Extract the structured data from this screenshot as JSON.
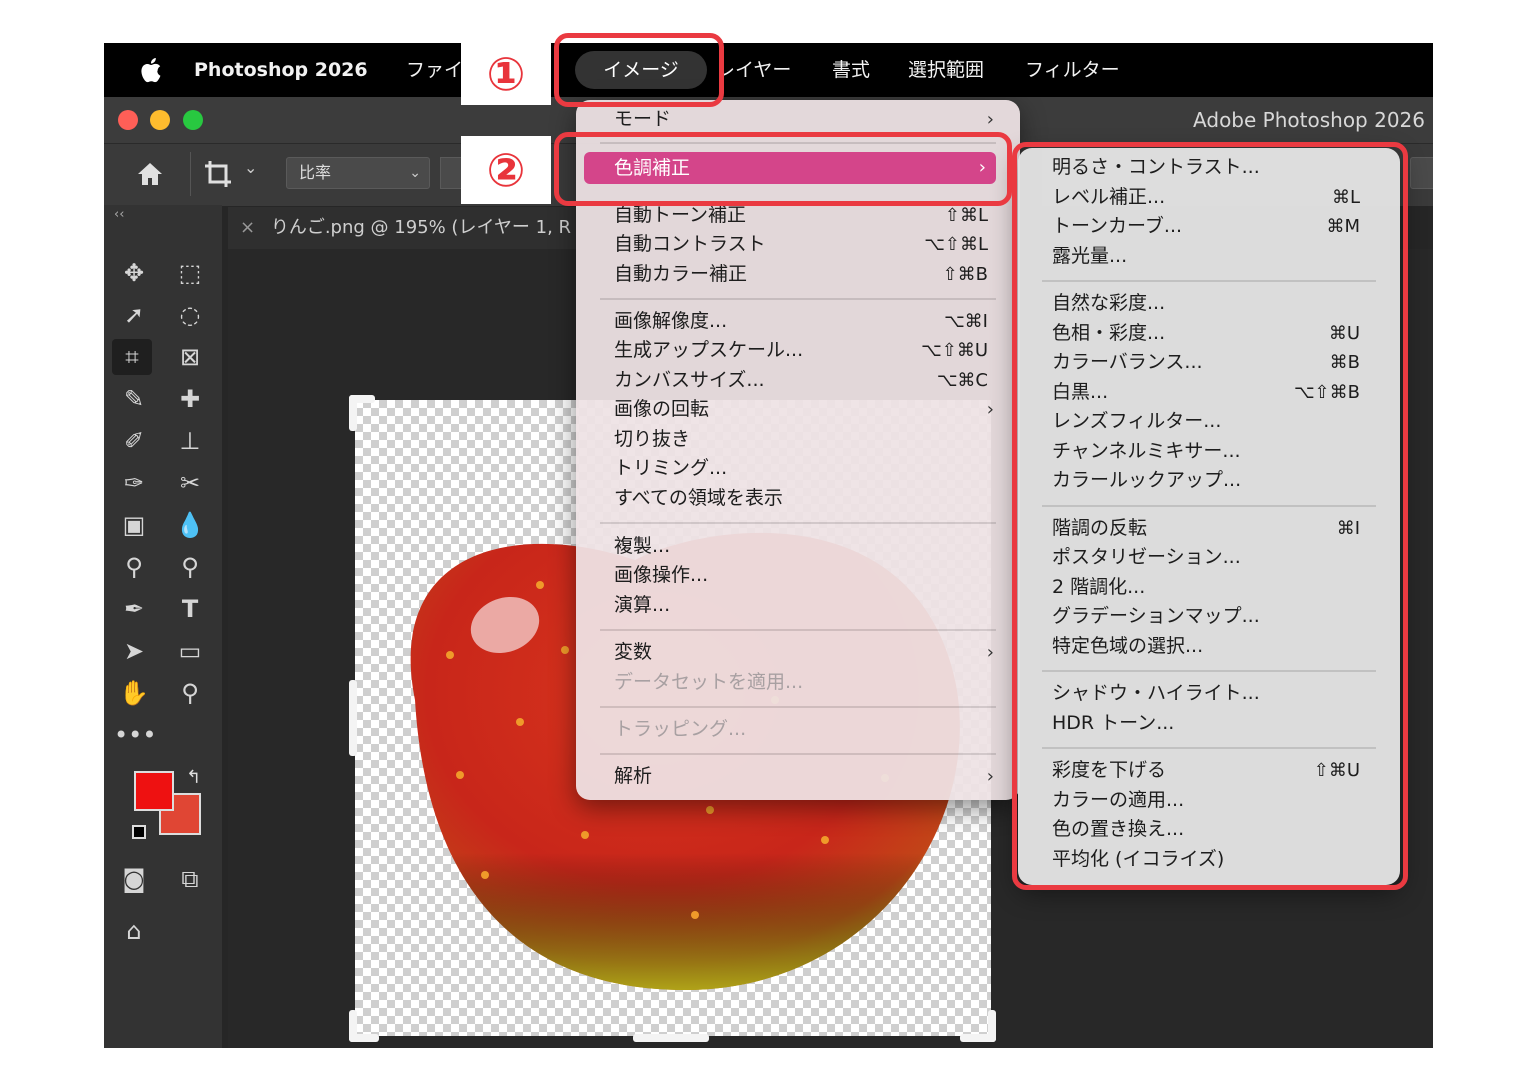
{
  "menubar": {
    "app_name": "Photoshop 2026",
    "items": [
      "ファイ",
      "イメージ",
      "レイヤー",
      "書式",
      "選択範囲",
      "フィルター"
    ]
  },
  "steps": [
    "①",
    "②"
  ],
  "window": {
    "title": "Adobe Photoshop 2026",
    "options_bar": {
      "ratio_label": "比率",
      "collapse": "‹‹",
      "chevron": "⌄"
    },
    "document_tab": {
      "close": "×",
      "title": "りんご.png @ 195% (レイヤー 1, R"
    }
  },
  "colors": {
    "foreground": "#ee1111",
    "background": "#e04634",
    "highlight": "#d4458a",
    "annotation": "#ea3a41"
  },
  "image_menu": {
    "items": [
      {
        "label": "モード",
        "shortcut": "",
        "submenu": true
      },
      {
        "label": "色調補正",
        "shortcut": "",
        "submenu": true,
        "highlighted": true
      },
      {
        "label": "自動トーン補正",
        "shortcut": "⇧⌘L"
      },
      {
        "label": "自動コントラスト",
        "shortcut": "⌥⇧⌘L"
      },
      {
        "label": "自動カラー補正",
        "shortcut": "⇧⌘B"
      },
      {
        "label": "画像解像度...",
        "shortcut": "⌥⌘I"
      },
      {
        "label": "生成アップスケール...",
        "shortcut": "⌥⇧⌘U"
      },
      {
        "label": "カンバスサイズ...",
        "shortcut": "⌥⌘C"
      },
      {
        "label": "画像の回転",
        "shortcut": "",
        "submenu": true
      },
      {
        "label": "切り抜き",
        "shortcut": ""
      },
      {
        "label": "トリミング...",
        "shortcut": ""
      },
      {
        "label": "すべての領域を表示",
        "shortcut": ""
      },
      {
        "label": "複製...",
        "shortcut": ""
      },
      {
        "label": "画像操作...",
        "shortcut": ""
      },
      {
        "label": "演算...",
        "shortcut": ""
      },
      {
        "label": "変数",
        "shortcut": "",
        "submenu": true
      },
      {
        "label": "データセットを適用...",
        "shortcut": "",
        "disabled": true
      },
      {
        "label": "トラッピング...",
        "shortcut": "",
        "disabled": true
      },
      {
        "label": "解析",
        "shortcut": "",
        "submenu": true
      }
    ]
  },
  "adjustments_submenu": {
    "items": [
      {
        "label": "明るさ・コントラスト...",
        "shortcut": ""
      },
      {
        "label": "レベル補正...",
        "shortcut": "⌘L"
      },
      {
        "label": "トーンカーブ...",
        "shortcut": "⌘M"
      },
      {
        "label": "露光量...",
        "shortcut": ""
      },
      {
        "label": "自然な彩度...",
        "shortcut": ""
      },
      {
        "label": "色相・彩度...",
        "shortcut": "⌘U"
      },
      {
        "label": "カラーバランス...",
        "shortcut": "⌘B"
      },
      {
        "label": "白黒...",
        "shortcut": "⌥⇧⌘B"
      },
      {
        "label": "レンズフィルター...",
        "shortcut": ""
      },
      {
        "label": "チャンネルミキサー...",
        "shortcut": ""
      },
      {
        "label": "カラールックアップ...",
        "shortcut": ""
      },
      {
        "label": "階調の反転",
        "shortcut": "⌘I"
      },
      {
        "label": "ポスタリゼーション...",
        "shortcut": ""
      },
      {
        "label": "2 階調化...",
        "shortcut": ""
      },
      {
        "label": "グラデーションマップ...",
        "shortcut": ""
      },
      {
        "label": "特定色域の選択...",
        "shortcut": ""
      },
      {
        "label": "シャドウ・ハイライト...",
        "shortcut": ""
      },
      {
        "label": "HDR トーン...",
        "shortcut": ""
      },
      {
        "label": "彩度を下げる",
        "shortcut": "⇧⌘U"
      },
      {
        "label": "カラーの適用...",
        "shortcut": ""
      },
      {
        "label": "色の置き換え...",
        "shortcut": ""
      },
      {
        "label": "平均化 (イコライズ)",
        "shortcut": ""
      }
    ]
  },
  "submenu_arrow": "›"
}
